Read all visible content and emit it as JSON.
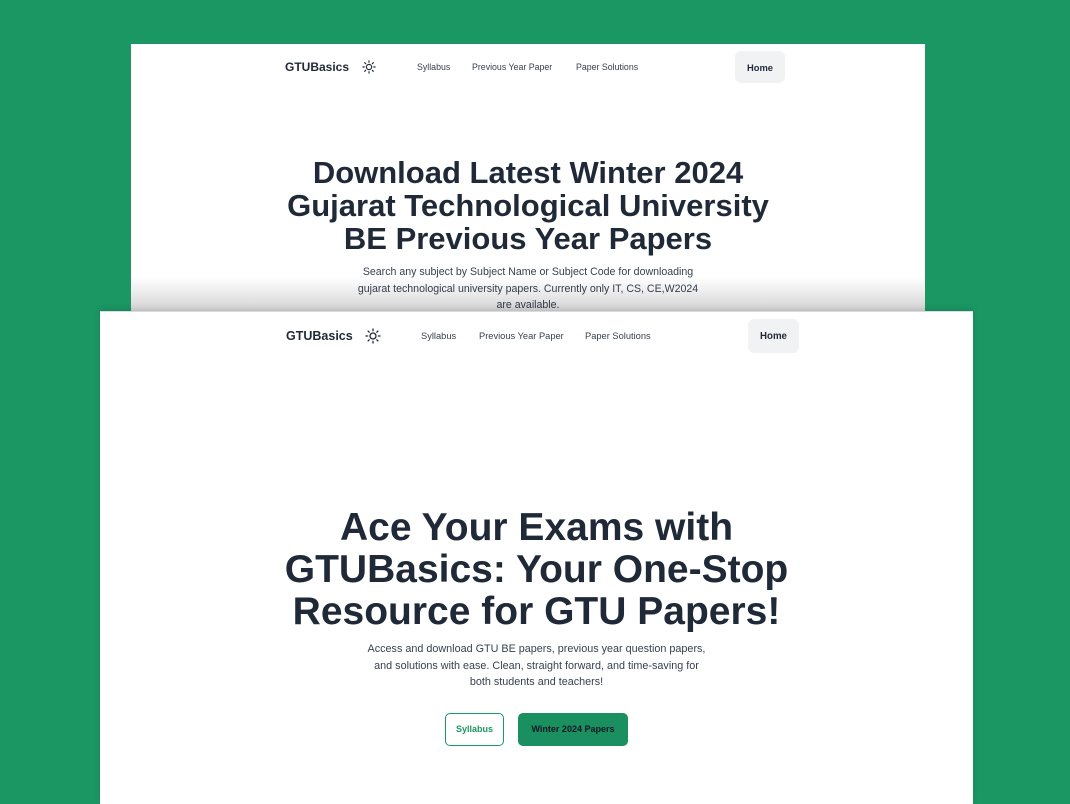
{
  "colors": {
    "page_background": "#1b9763",
    "accent": "#1b9763",
    "accent_dark": "#1a8f5f",
    "heading_text": "#1f2937",
    "body_text": "#374151",
    "home_button_bg": "#f1f2f4",
    "button_dark_text": "#111827"
  },
  "back_page": {
    "nav": {
      "logo": "GTUBasics",
      "theme_icon": "sun-icon",
      "links": [
        "Syllabus",
        "Previous Year Paper",
        "Paper Solutions"
      ],
      "home_button": "Home"
    },
    "hero": {
      "heading_lines": [
        "Download Latest Winter 2024",
        "Gujarat Technological University",
        "BE Previous Year Papers"
      ],
      "description_lines": [
        "Search any subject by Subject Name or Subject Code for downloading",
        "gujarat technological university papers. Currently only IT, CS, CE,W2024",
        "are available."
      ]
    }
  },
  "front_page": {
    "nav": {
      "logo": "GTUBasics",
      "theme_icon": "sun-icon",
      "links": [
        "Syllabus",
        "Previous Year Paper",
        "Paper Solutions"
      ],
      "home_button": "Home"
    },
    "hero": {
      "heading_lines": [
        "Ace Your Exams with",
        "GTUBasics: Your One-Stop",
        "Resource for GTU Papers!"
      ],
      "description_lines": [
        "Access and download GTU BE papers, previous year question papers,",
        "and solutions with ease. Clean, straight forward, and time-saving for",
        "both students and teachers!"
      ],
      "buttons": {
        "syllabus": "Syllabus",
        "winter_papers": "Winter 2024 Papers"
      }
    }
  }
}
